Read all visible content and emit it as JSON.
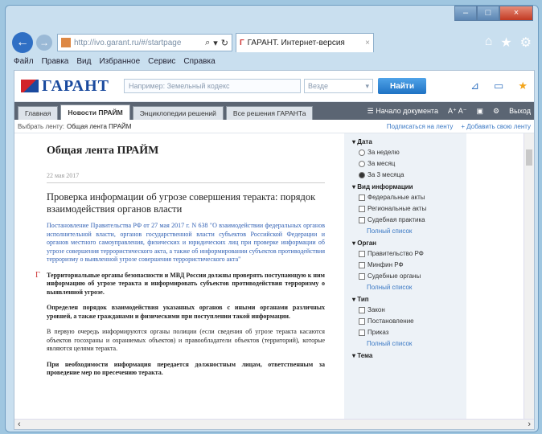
{
  "browser": {
    "address_text": "http://ivo.garant.ru/#/startpage",
    "tab_title": "ГАРАНТ. Интернет-версия",
    "window_controls": [
      "–",
      "□",
      "×"
    ],
    "nav_icons": [
      "home-icon",
      "star-icon",
      "gear-icon"
    ]
  },
  "menu": [
    "Файл",
    "Правка",
    "Вид",
    "Избранное",
    "Сервис",
    "Справка"
  ],
  "garant": {
    "logo": "ГАРАНТ",
    "search_placeholder": "Например: Земельный кодекс",
    "select_value": "Везде",
    "find_label": "Найти"
  },
  "tabs": [
    "Главная",
    "Новости ПРАЙМ",
    "Энциклопедии решений",
    "Все решения ГАРАНТа"
  ],
  "tools": {
    "recent": "☰ Начало документа",
    "font": "A⁺ A⁻",
    "exit": "Выход"
  },
  "feedbar": {
    "label": "Выбрать ленту:",
    "value": "Общая лента ПРАЙМ",
    "links": [
      "Подписаться на ленту",
      "+ Добавить свою ленту"
    ]
  },
  "article": {
    "title": "Общая лента ПРАЙМ",
    "date": "22 мая 2017",
    "headline": "Проверка информации об угрозе совершения теракта: порядок взаимодействия органов власти",
    "lead": "Постановление Правительства РФ от 27 мая 2017 г. N 638 \"О взаимодействии федеральных органов исполнительной власти, органов государственной власти субъектов Российской Федерации и органов местного самоуправления, физических и юридических лиц при проверке информации об угрозе совершения террористического акта, а также об информировании субъектов противодействия терроризму о выявленной угрозе совершения террористического акта\"",
    "p1": "Территориальные органы безопасности и МВД России должны проверять поступающую к ним информацию об угрозе теракта и информировать субъектов противодействия терроризму о выявленной угрозе.",
    "p2": "Определен порядок взаимодействия указанных органов с иными органами различных уровней, а также гражданами и физическими при поступлении такой информации.",
    "p3": "В первую очередь информируются органы полиции (если сведения об угрозе теракта касаются объектов госохраны и охраняемых объектов) и правообладатели объектов (территорий), которые являются целями теракта.",
    "p4": "При необходимости информация передается должностным лицам, ответственным за проведение мер по пресечению теракта."
  },
  "sidebar": {
    "date": {
      "title": "Дата",
      "options": [
        "За неделю",
        "За месяц",
        "За 3 месяца"
      ],
      "selected": 2
    },
    "type": {
      "title": "Вид информации",
      "options": [
        "Федеральные акты",
        "Региональные акты",
        "Судебная практика"
      ],
      "more": "Полный список"
    },
    "organ": {
      "title": "Орган",
      "options": [
        "Правительство РФ",
        "Минфин РФ",
        "Судебные органы"
      ],
      "more": "Полный список"
    },
    "doctype": {
      "title": "Тип",
      "options": [
        "Закон",
        "Постановление",
        "Приказ"
      ],
      "more": "Полный список"
    },
    "topic": {
      "title": "Тема"
    }
  }
}
